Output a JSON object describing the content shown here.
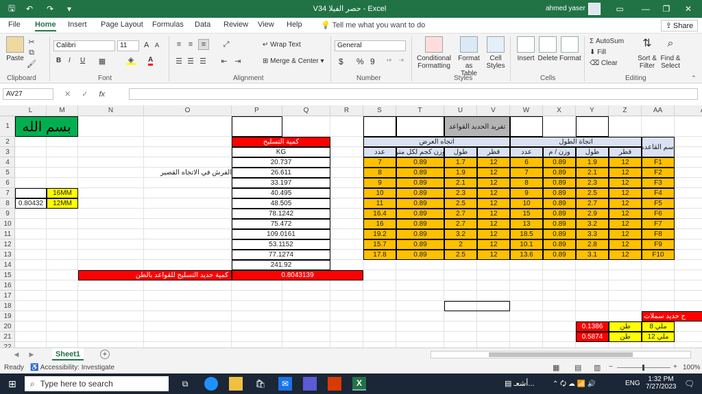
{
  "window": {
    "title": "V34 حصر الفيلا - Excel",
    "user": "ahmed yaser"
  },
  "menu": {
    "tabs": [
      "File",
      "Home",
      "Insert",
      "Page Layout",
      "Formulas",
      "Data",
      "Review",
      "View",
      "Help"
    ],
    "tell_me": "Tell me what you want to do",
    "share": "Share"
  },
  "ribbon": {
    "clipboard": {
      "paste": "Paste",
      "label": "Clipboard"
    },
    "font": {
      "name": "Calibri",
      "size": "11",
      "grow": "A",
      "shrink": "A",
      "bold": "B",
      "italic": "I",
      "underline": "U",
      "font_color": "A",
      "label": "Font"
    },
    "alignment": {
      "wrap": "Wrap Text",
      "merge": "Merge & Center",
      "label": "Alignment"
    },
    "number": {
      "format": "General",
      "currency": "$",
      "percent": "%",
      "comma": "9",
      "label": "Number"
    },
    "styles": {
      "conditional": "Conditional",
      "conditional2": "Formatting",
      "format_table": "Format as",
      "format_table2": "Table",
      "cell_styles": "Cell",
      "cell_styles2": "Styles",
      "label": "Styles"
    },
    "cells": {
      "insert": "Insert",
      "delete": "Delete",
      "format": "Format",
      "label": "Cells"
    },
    "editing": {
      "autosum": "AutoSum",
      "fill": "Fill",
      "clear": "Clear",
      "sort": "Sort &",
      "sort2": "Filter",
      "find": "Find &",
      "find2": "Select",
      "label": "Editing"
    }
  },
  "formula_bar": {
    "name_box": "AV27",
    "fx": "fx",
    "cancel": "✕",
    "enter": "✓",
    "content": ""
  },
  "columns": [
    "L",
    "M",
    "N",
    "O",
    "P",
    "Q",
    "R",
    "S",
    "T",
    "U",
    "V",
    "W",
    "X",
    "Y",
    "Z",
    "AA",
    "AB"
  ],
  "rows": [
    "1",
    "2",
    "3",
    "4",
    "5",
    "6",
    "7",
    "8",
    "9",
    "10",
    "11",
    "12",
    "13",
    "14",
    "15",
    "16",
    "17",
    "18",
    "19",
    "20",
    "21",
    "22"
  ],
  "cells": {
    "basmala": "بسم الله",
    "note_o5": "الفرش في الاتجاه القصير",
    "m7": "16MM",
    "m8": "12MM",
    "l8": "0.80432",
    "u1": "تفريد الحديد القواعد",
    "p2": "كمية التسليح",
    "q3": "KG",
    "width_dir": "اتجاه العرض",
    "length_dir": "اتجاة الطول",
    "base_name": "اسم القاعده",
    "h_count": "عدد",
    "h_weight_w": "وزن كجم لكل متر",
    "h_len": "طول",
    "h_dia": "قطر",
    "h_count2": "عدد",
    "h_weight_l": "وزن / م",
    "h_len2": "طول",
    "h_dia2": "قطر",
    "q14": "241.92",
    "o15": "كمية حديد التسليح للقواعد بالطن",
    "q15": "0.8043139",
    "aa19": "ح حديد سملات",
    "y20": "0.1386",
    "z20": "طن",
    "aa20": "ملي 8",
    "y21": "0.5874",
    "z21": "طن",
    "aa21": "ملي 12"
  },
  "table": [
    {
      "kg": "20.737",
      "s": "7",
      "t": "0.89",
      "u": "1.7",
      "v": "12",
      "w": "6",
      "x": "0.89",
      "y": "1.9",
      "z": "12",
      "aa": "F1"
    },
    {
      "kg": "26.611",
      "s": "8",
      "t": "0.89",
      "u": "1.9",
      "v": "12",
      "w": "7",
      "x": "0.89",
      "y": "2.1",
      "z": "12",
      "aa": "F2"
    },
    {
      "kg": "33.197",
      "s": "9",
      "t": "0.89",
      "u": "2.1",
      "v": "12",
      "w": "8",
      "x": "0.89",
      "y": "2.3",
      "z": "12",
      "aa": "F3"
    },
    {
      "kg": "40.495",
      "s": "10",
      "t": "0.89",
      "u": "2.3",
      "v": "12",
      "w": "9",
      "x": "0.89",
      "y": "2.5",
      "z": "12",
      "aa": "F4"
    },
    {
      "kg": "48.505",
      "s": "11",
      "t": "0.89",
      "u": "2.5",
      "v": "12",
      "w": "10",
      "x": "0.89",
      "y": "2.7",
      "z": "12",
      "aa": "F5"
    },
    {
      "kg": "78.1242",
      "s": "16.4",
      "t": "0.89",
      "u": "2.7",
      "v": "12",
      "w": "15",
      "x": "0.89",
      "y": "2.9",
      "z": "12",
      "aa": "F6"
    },
    {
      "kg": "75.472",
      "s": "16",
      "t": "0.89",
      "u": "2.7",
      "v": "12",
      "w": "13",
      "x": "0.89",
      "y": "3.2",
      "z": "12",
      "aa": "F7"
    },
    {
      "kg": "109.0161",
      "s": "19.2",
      "t": "0.89",
      "u": "3.2",
      "v": "12",
      "w": "18.5",
      "x": "0.89",
      "y": "3.3",
      "z": "12",
      "aa": "F8"
    },
    {
      "kg": "53.1152",
      "s": "15.7",
      "t": "0.89",
      "u": "2",
      "v": "12",
      "w": "10.1",
      "x": "0.89",
      "y": "2.8",
      "z": "12",
      "aa": "F9"
    },
    {
      "kg": "77.1274",
      "s": "17.8",
      "t": "0.89",
      "u": "2.5",
      "v": "12",
      "w": "13.6",
      "x": "0.89",
      "y": "3.1",
      "z": "12",
      "aa": "F10"
    }
  ],
  "sheet": {
    "tab": "Sheet1",
    "add": "+"
  },
  "status": {
    "ready": "Ready",
    "accessibility": "Accessibility: Investigate",
    "zoom": "100%"
  },
  "taskbar": {
    "search": "Type here to search",
    "time": "1:32 PM",
    "date": "7/27/2023",
    "lang": "ENG",
    "news": "أشعـ..."
  }
}
